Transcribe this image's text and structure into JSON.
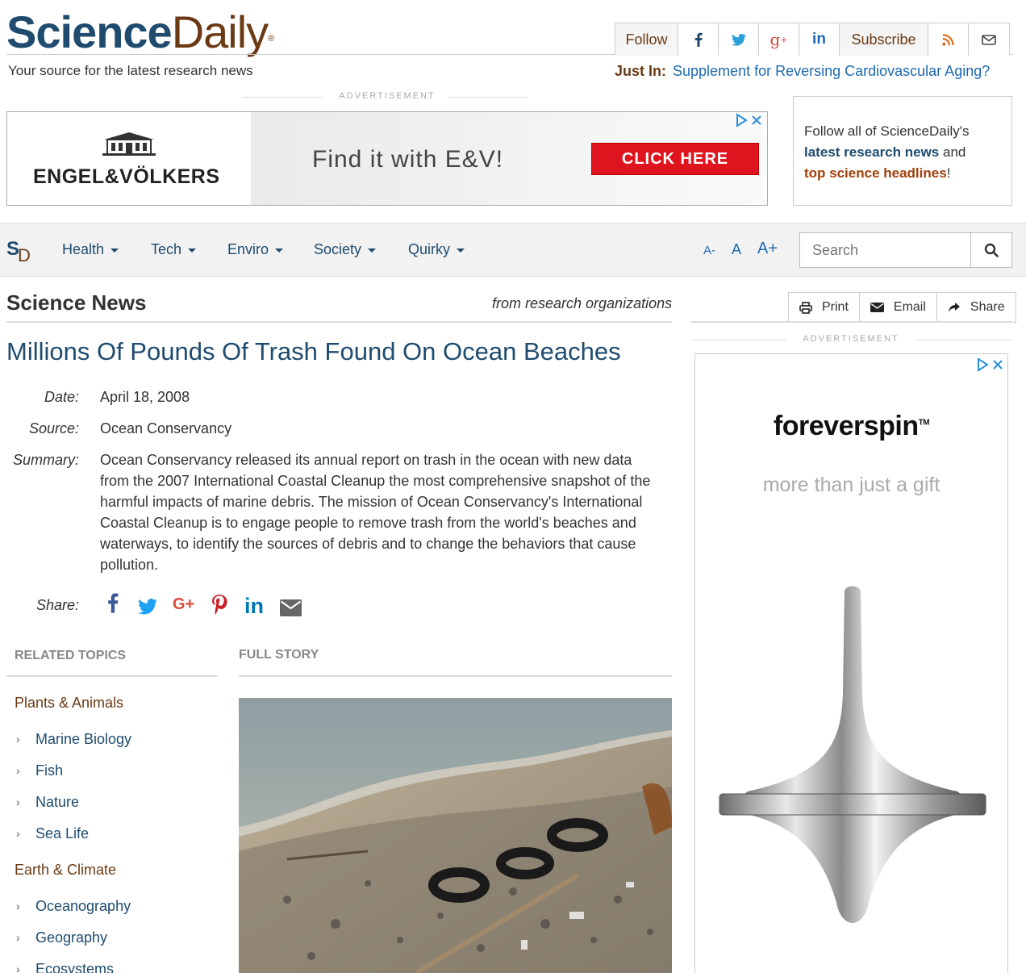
{
  "header": {
    "logo_part1": "Science",
    "logo_part2": "Daily",
    "logo_reg": "®",
    "tagline": "Your source for the latest research news",
    "follow_label": "Follow",
    "subscribe_label": "Subscribe",
    "just_in_label": "Just In:",
    "just_in_link": "Supplement for Reversing Cardiovascular Aging?"
  },
  "ads": {
    "label": "ADVERTISEMENT",
    "top": {
      "brand": "ENGEL&VÖLKERS",
      "headline": "Find it with E&V!",
      "cta": "CLICK HERE"
    },
    "side": {
      "brand": "foreverspin",
      "tm": "TM",
      "tagline": "more than just a gift"
    }
  },
  "follow_box": {
    "line1": "Follow all of ScienceDaily's",
    "link1": "latest research news",
    "and": " and",
    "link2": "top science headlines",
    "end": "!"
  },
  "nav": {
    "logo_s": "S",
    "logo_d": "D",
    "items": [
      "Health",
      "Tech",
      "Enviro",
      "Society",
      "Quirky"
    ],
    "font_small": "A-",
    "font_normal": "A",
    "font_large": "A+",
    "search_placeholder": "Search"
  },
  "section": {
    "title": "Science News",
    "subtitle": "from research organizations"
  },
  "tools": {
    "print": "Print",
    "email": "Email",
    "share": "Share"
  },
  "article": {
    "headline": "Millions Of Pounds Of Trash Found On Ocean Beaches",
    "date_label": "Date:",
    "date": "April 18, 2008",
    "source_label": "Source:",
    "source": "Ocean Conservancy",
    "summary_label": "Summary:",
    "summary": "Ocean Conservancy released its annual report on trash in the ocean with new data from the 2007 International Coastal Cleanup the most comprehensive snapshot of the harmful impacts of marine debris. The mission of Ocean Conservancy's International Coastal Cleanup is to engage people to remove trash from the world's beaches and waterways, to identify the sources of debris and to change the behaviors that cause pollution.",
    "share_label": "Share:"
  },
  "related": {
    "heading": "RELATED TOPICS",
    "categories": [
      {
        "name": "Plants & Animals",
        "topics": [
          "Marine Biology",
          "Fish",
          "Nature",
          "Sea Life"
        ]
      },
      {
        "name": "Earth & Climate",
        "topics": [
          "Oceanography",
          "Geography",
          "Ecosystems"
        ]
      }
    ]
  },
  "full_story": {
    "heading": "FULL STORY"
  },
  "colors": {
    "brand_blue": "#1e4b6e",
    "brand_brown": "#6b3a14",
    "link_blue": "#1e6ab0"
  }
}
